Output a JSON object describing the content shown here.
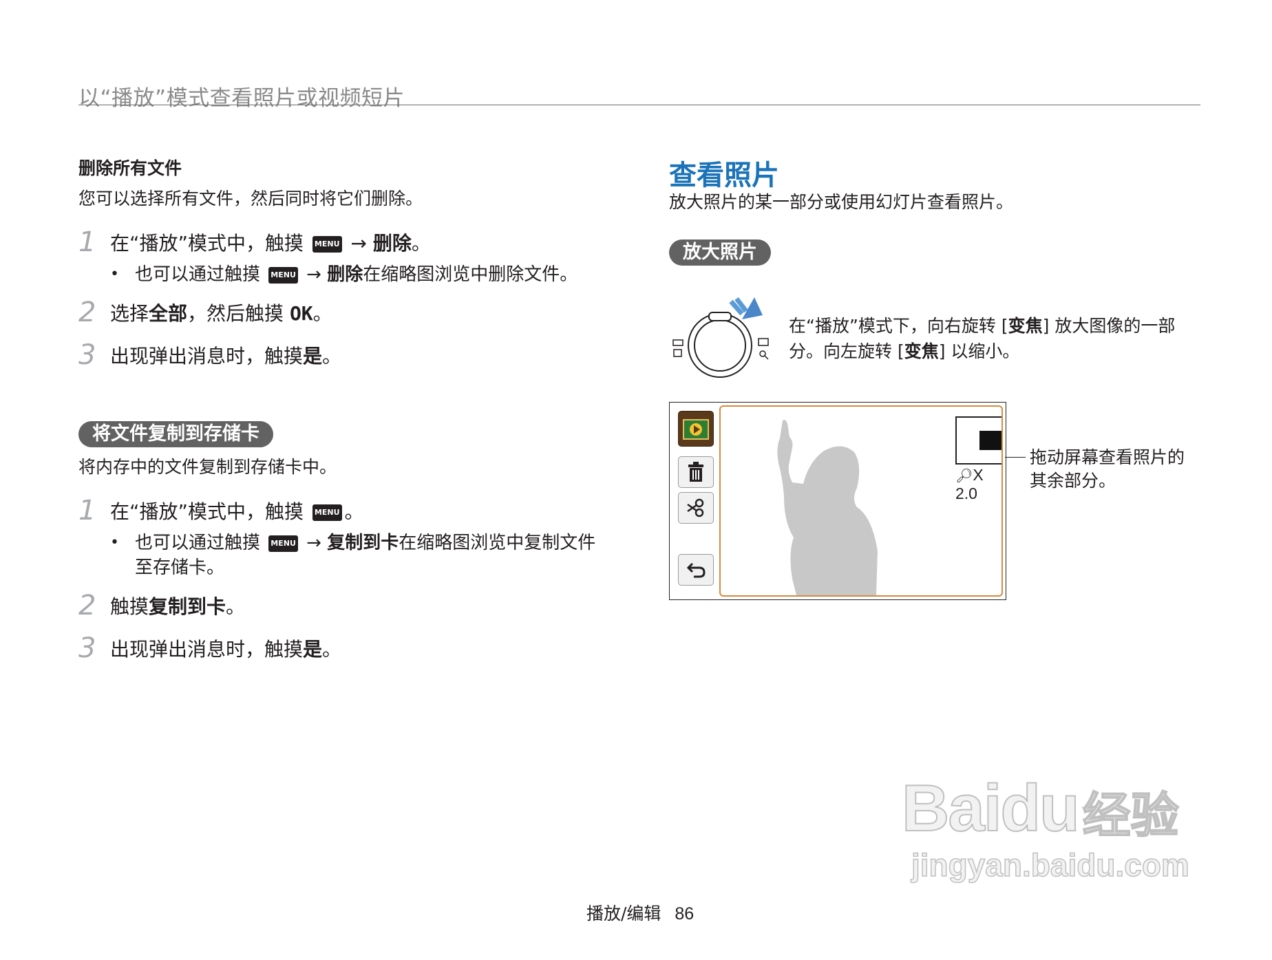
{
  "header": {
    "title": "以“播放”模式查看照片或视频短片"
  },
  "left": {
    "delete_all": {
      "heading": "删除所有文件",
      "intro": "您可以选择所有文件，然后同时将它们删除。",
      "step1": {
        "num": "1",
        "pre": "在“播放”模式中，触摸",
        "key": "MENU",
        "arrow": "→",
        "bold": "删除",
        "post": "。"
      },
      "bullet1": {
        "dot": "•",
        "pre": "也可以通过触摸",
        "key": "MENU",
        "arrow": "→",
        "bold": "删除",
        "post": "在缩略图浏览中删除文件。"
      },
      "step2": {
        "num": "2",
        "pre": "选择",
        "bold": "全部",
        "mid": "，然后触摸",
        "ok": "OK",
        "post": "。"
      },
      "step3": {
        "num": "3",
        "pre": "出现弹出消息时，触摸",
        "bold": "是",
        "post": "。"
      }
    },
    "copy": {
      "pill": "将文件复制到存储卡",
      "intro": "将内存中的文件复制到存储卡中。",
      "step1": {
        "num": "1",
        "pre": "在“播放”模式中，触摸",
        "key": "MENU",
        "post": "。"
      },
      "bullet1": {
        "dot": "•",
        "pre": "也可以通过触摸",
        "key": "MENU",
        "arrow": "→",
        "bold": "复制到卡",
        "post": "在缩略图浏览中复制文件",
        "line2": "至存储卡。"
      },
      "step2": {
        "num": "2",
        "pre": "触摸",
        "bold": "复制到卡",
        "post": "。"
      },
      "step3": {
        "num": "3",
        "pre": "出现弹出消息时，触摸",
        "bold": "是",
        "post": "。"
      }
    }
  },
  "right": {
    "title": "查看照片",
    "intro": "放大照片的某一部分或使用幻灯片查看照片。",
    "pill": "放大照片",
    "zoom_text": {
      "l1_pre": "在“播放”模式下，向右旋转 [",
      "l1_bold": "变焦",
      "l1_post": "] 放大图像的一部",
      "l2_pre": "分。向左旋转 [",
      "l2_bold": "变焦",
      "l2_post": "] 以缩小。"
    },
    "screen": {
      "zoom_label": "X 2.0"
    },
    "callout": {
      "line1": "拖动屏幕查看照片的",
      "line2": "其余部分。"
    }
  },
  "footer": {
    "section": "播放/编辑",
    "page": "86"
  },
  "watermark": {
    "brand": "Baidu",
    "cn": "经验",
    "url": "jingyan.baidu.com"
  },
  "colors": {
    "accent_blue": "#1b73b8",
    "pill_gray": "#626262",
    "frame_orange": "#d78a3e"
  }
}
